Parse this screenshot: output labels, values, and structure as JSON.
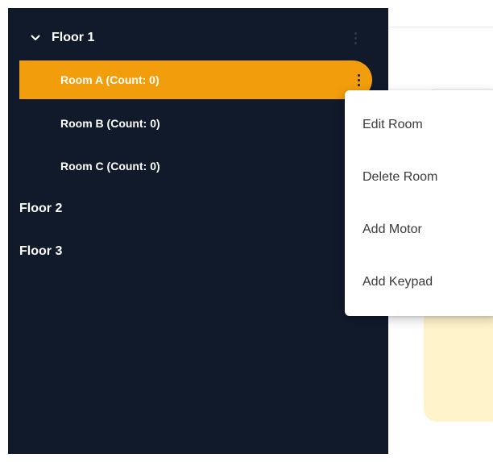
{
  "colors": {
    "sidebar_background": "#101a2b",
    "selected_row": "#f29d0b",
    "notice_background": "#fff3cc",
    "menu_text": "#3a3a3a"
  },
  "sidebar": {
    "floors": [
      {
        "label": "Floor 1",
        "expanded": true,
        "rooms": [
          {
            "label": "Room A (Count: 0)",
            "selected": true
          },
          {
            "label": "Room B (Count: 0)",
            "selected": false
          },
          {
            "label": "Room C (Count: 0)",
            "selected": false
          }
        ]
      },
      {
        "label": "Floor 2",
        "expanded": false
      },
      {
        "label": "Floor 3",
        "expanded": false
      }
    ]
  },
  "context_menu": {
    "items": [
      {
        "label": "Edit Room"
      },
      {
        "label": "Delete Room"
      },
      {
        "label": "Add Motor"
      },
      {
        "label": "Add Keypad"
      }
    ]
  },
  "icons": {
    "floor_toggle": "chevron-down-icon",
    "more_options": "more-vertical-icon"
  }
}
